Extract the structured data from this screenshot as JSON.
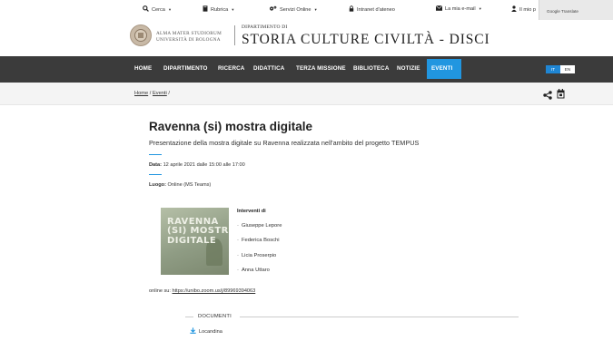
{
  "topbar": {
    "items": [
      {
        "icon": "search-icon",
        "label": "Cerca",
        "caret": true
      },
      {
        "icon": "book-icon",
        "label": "Rubrica",
        "caret": true
      },
      {
        "icon": "gears-icon",
        "label": "Servizi Online",
        "caret": true
      },
      {
        "icon": "lock-icon",
        "label": "Intranet d'ateneo",
        "caret": false
      },
      {
        "icon": "envelope-icon",
        "label": "La mia e-mail",
        "caret": true
      },
      {
        "icon": "user-icon",
        "label": "Il mio p",
        "caret": false
      }
    ],
    "google_translate": "Google Translate"
  },
  "brand": {
    "alma_line1": "ALMA MATER STUDIORUM",
    "alma_line2": "UNIVERSITÀ DI BOLOGNA",
    "dept_small": "DIPARTIMENTO DI",
    "dept_big": "STORIA CULTURE CIVILTÀ - DISCI"
  },
  "nav": {
    "items": [
      "HOME",
      "DIPARTIMENTO",
      "RICERCA",
      "DIDATTICA",
      "TERZA MISSIONE",
      "BIBLIOTECA",
      "NOTIZIE",
      "EVENTI"
    ],
    "active": "EVENTI",
    "lang": [
      "IT",
      "EN"
    ],
    "active_lang": "IT",
    "accent": "#2196e0",
    "bar_color": "#3b3b3b"
  },
  "breadcrumb": {
    "home": "Home",
    "sep": "/",
    "current": "Eventi",
    "trail": "/"
  },
  "event": {
    "title": "Ravenna (si) mostra digitale",
    "subtitle": "Presentazione della mostra digitale su Ravenna realizzata nell'ambito del progetto TEMPUS",
    "date_label": "Data:",
    "date_value": "12 aprile 2021 dalle 15:00 alle 17:00",
    "place_label": "Luogo:",
    "place_value": "Online (MS Teams)",
    "image_text": "RAVENNA\n(SI) MOSTRA\nDIGITALE",
    "speakers_title": "Interventi di",
    "speakers": [
      "Giuseppe Lepore",
      "Federica Boschi",
      "Licia Proserpio",
      "Anna Uttaro"
    ],
    "online_label": "online su:",
    "online_url": "https://unibo.zoom.us/j/89969394063",
    "documents_label": "DOCUMENTI",
    "documents": [
      "Locandina"
    ]
  }
}
